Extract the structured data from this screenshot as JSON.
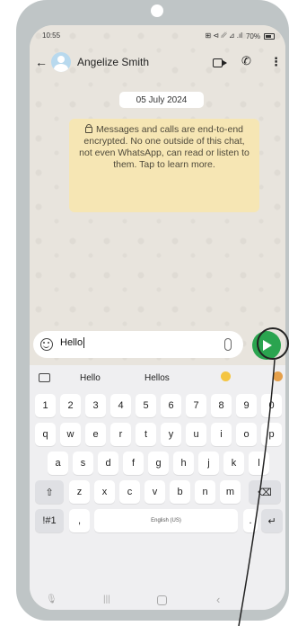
{
  "status_bar": {
    "time": "10:55",
    "icons": "⊞ ⊲ ␥ ⊿ .ıl",
    "battery_text": "70%"
  },
  "header": {
    "back_icon": "←",
    "contact_name": "Angelize Smith",
    "call_icon": "✆",
    "menu_icon": "⋮"
  },
  "chat": {
    "date": "05 July 2024",
    "encryption_notice": "Messages and calls are end-to-end encrypted. No one outside of this chat, not even WhatsApp, can read or listen to them. Tap to learn more."
  },
  "composer": {
    "text": "Hello"
  },
  "keyboard": {
    "suggestions": [
      "Hello",
      "Hellos"
    ],
    "rows": [
      [
        "1",
        "2",
        "3",
        "4",
        "5",
        "6",
        "7",
        "8",
        "9",
        "0"
      ],
      [
        "q",
        "w",
        "e",
        "r",
        "t",
        "y",
        "u",
        "i",
        "o",
        "p"
      ],
      [
        "a",
        "s",
        "d",
        "f",
        "g",
        "h",
        "j",
        "k",
        "l"
      ],
      [
        "⇧",
        "z",
        "x",
        "c",
        "v",
        "b",
        "n",
        "m",
        "⌫"
      ],
      [
        "!#1",
        ",",
        "English (US)",
        ".",
        "↵"
      ]
    ]
  },
  "nav": {
    "mic": "🎙",
    "recents": "|||",
    "back": "‹"
  },
  "colors": {
    "send_button": "#2aa44f",
    "encryption_bg": "#f6e6b4",
    "phone_frame": "#bfc5c6",
    "chat_bg": "#e8e4dd"
  },
  "icons": [
    "back-arrow-icon",
    "video-call-icon",
    "phone-call-icon",
    "menu-icon",
    "emoji-icon",
    "attach-icon",
    "send-icon",
    "lock-icon"
  ]
}
